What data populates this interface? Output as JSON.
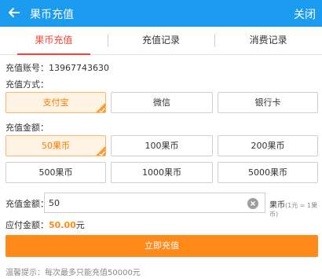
{
  "topbar": {
    "title": "果币充值",
    "close_label": "关闭"
  },
  "tabs": [
    {
      "label": "果币充值",
      "active": true
    },
    {
      "label": "充值记录",
      "active": false
    },
    {
      "label": "消费记录",
      "active": false
    }
  ],
  "account": {
    "label": "充值账号：",
    "value": "13967743630"
  },
  "method": {
    "label": "充值方式：",
    "options": [
      "支付宝",
      "微信",
      "银行卡"
    ],
    "selected": "支付宝"
  },
  "amount_section": {
    "label": "充值金额：",
    "options": [
      "50果币",
      "100果币",
      "200果币",
      "500果币",
      "1000果币",
      "5000果币"
    ],
    "selected": "50果币"
  },
  "custom_amount": {
    "label": "充值金额：",
    "value": "50",
    "unit": "果币",
    "rate_note": "(1元 = 1果币)"
  },
  "payable": {
    "label": "应付金额：",
    "amount": "50.00",
    "currency": "元"
  },
  "submit_label": "立即充值",
  "tip": "温馨提示：每次最多只能充值50000元",
  "colors": {
    "header": "#1a9bf0",
    "accent": "#ff8a1a",
    "active_tab": "#f44336"
  }
}
